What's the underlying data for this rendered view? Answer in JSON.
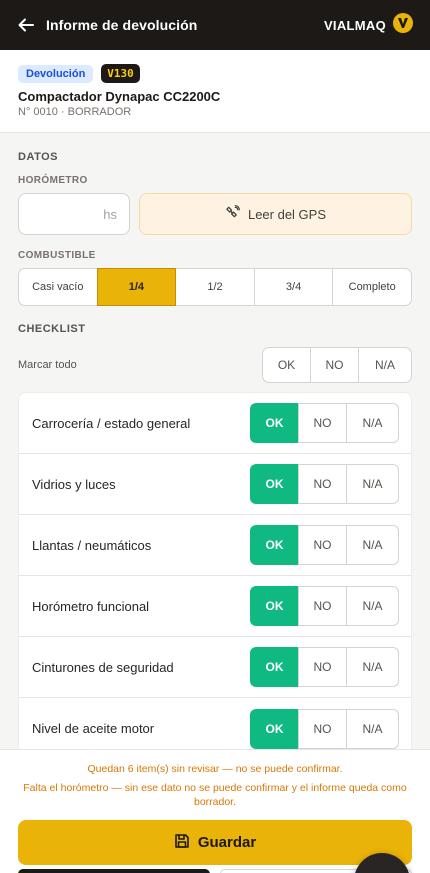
{
  "topbar": {
    "title": "Informe de devolución",
    "brand": "VIALMAQ",
    "colors": {
      "bg": "#1c1917",
      "brand_accent": "#eab308"
    }
  },
  "header": {
    "type_badge": "Devolución",
    "code_badge": "V130",
    "machine": "Compactador Dynapac CC2200C",
    "meta": "N° 0010 · BORRADOR"
  },
  "datos": {
    "section": "DATOS",
    "horometro_label": "HORÓMETRO",
    "horometro_value": "",
    "horometro_unit": "hs",
    "gps_button": "Leer del GPS"
  },
  "combustible": {
    "label": "COMBUSTIBLE",
    "options": [
      "Casi vacío",
      "1/4",
      "1/2",
      "3/4",
      "Completo"
    ],
    "selected": "1/4"
  },
  "checklist": {
    "section": "CHECKLIST",
    "mark_all_label": "Marcar todo",
    "mark_all_options": [
      "OK",
      "NO",
      "N/A"
    ],
    "items": [
      {
        "label": "Carrocería / estado general",
        "value": "OK"
      },
      {
        "label": "Vidrios y luces",
        "value": "OK"
      },
      {
        "label": "Llantas / neumáticos",
        "value": "OK"
      },
      {
        "label": "Horómetro funcional",
        "value": "OK"
      },
      {
        "label": "Cinturones de seguridad",
        "value": "OK"
      },
      {
        "label": "Nivel de aceite motor",
        "value": "OK"
      }
    ],
    "option_labels": [
      "OK",
      "NO",
      "N/A"
    ],
    "colors": {
      "ok": "#10b981"
    }
  },
  "footer": {
    "warning_1": "Quedan 6 item(s) sin revisar — no se puede confirmar.",
    "warning_2": "Falta el horómetro — sin ese dato no se puede confirmar y el informe queda como borrador.",
    "save_label": "Guardar",
    "colors": {
      "warning": "#d97706",
      "save": "#eab308"
    }
  }
}
